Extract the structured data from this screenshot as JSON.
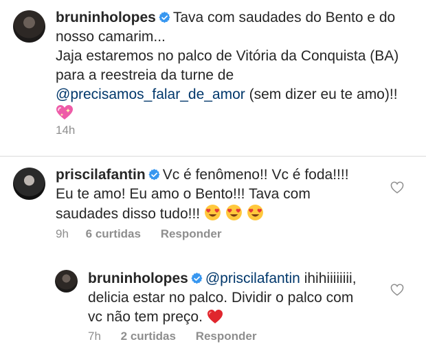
{
  "comments": [
    {
      "username": "bruninholopes",
      "lines": [
        "Tava com saudades do Bento e do",
        "nosso camarim...",
        "Jaja estaremos no palco de Vitória da Conquista (BA)",
        "para a reestreia da turne de"
      ],
      "mention": "@precisamos_falar_de_amor",
      "after_mention": " (sem dizer eu te amo)!!",
      "emoji": "sparkling-heart",
      "time": "14h"
    },
    {
      "username": "priscilafantin",
      "lines": [
        "Vc é fenômeno!! Vc é foda!!!!",
        "Eu te amo! Eu amo o Bento!!! Tava com",
        "saudades disso tudo!!!"
      ],
      "emoji": "heart-eyes-x3",
      "time": "9h",
      "likes": "6 curtidas",
      "reply_label": "Responder"
    },
    {
      "username": "bruninholopes",
      "mention": "@priscilafantin",
      "first_line_rest": " ihihiiiiiiii,",
      "lines": [
        "delicia estar no palco. Dividir o palco com",
        "vc não tem preço."
      ],
      "emoji": "red-heart",
      "time": "7h",
      "likes": "2 curtidas",
      "reply_label": "Responder"
    }
  ],
  "colors": {
    "verified": "#3897f0",
    "mention": "#00376b",
    "meta": "#8e8e8e"
  }
}
